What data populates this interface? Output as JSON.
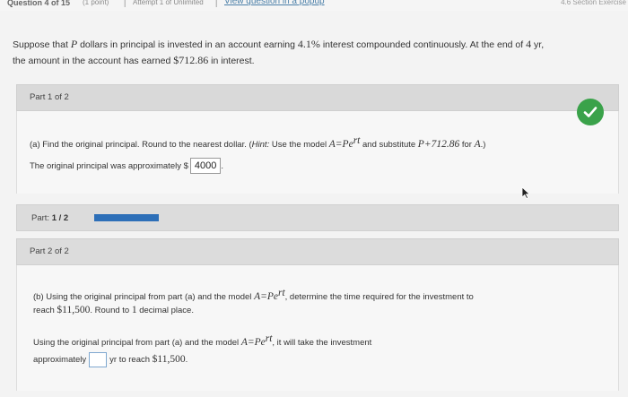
{
  "topbar": {
    "question_label": "Question 4 of 15",
    "points": "(1 point)",
    "attempt": "Attempt 1 of Unlimited",
    "popup_link": "View question in a popup",
    "section": "4.6 Section Exercise"
  },
  "question": {
    "text_1": "Suppose that",
    "var_p": "P",
    "text_2": "dollars in principal is invested in an account earning",
    "rate": "4.1%",
    "text_3": "interest compounded continuously. At the end of",
    "years": "4",
    "text_4": "yr,",
    "text_5": "the amount in the account has earned",
    "interest": "$712.86",
    "text_6": "in interest."
  },
  "part1": {
    "header": "Part 1 of 2",
    "prompt_prefix": "(a) Find the original principal. Round to the nearest dollar. (",
    "hint_label": "Hint:",
    "prompt_mid": " Use the model ",
    "model": "A=Pe",
    "exponent": "rt",
    "prompt_sub": " and substitute ",
    "substitute": "P+712.86",
    "prompt_for": " for ",
    "var_a": "A",
    "prompt_end": ".)",
    "answer_prefix": "The original principal was approximately",
    "currency": "$",
    "answer_value": "4000",
    "answer_suffix": "."
  },
  "progress": {
    "label": "Part:",
    "value": "1 / 2",
    "fraction": 1.0
  },
  "part2": {
    "header": "Part 2 of 2",
    "prompt_1": "(b) Using the original principal from part (a) and the model",
    "model": "A=Pe",
    "exponent": "rt",
    "prompt_2": ", determine the time required for the investment to",
    "prompt_3": "reach",
    "target": "$11,500",
    "prompt_4": ". Round to",
    "decimals": "1",
    "prompt_5": "decimal place.",
    "answer_1": "Using the original principal from part (a) and the model",
    "answer_2": ", it will take the investment",
    "answer_3": "approximately",
    "answer_4": "yr to reach",
    "answer_target": "$11,500",
    "answer_end": "."
  },
  "colors": {
    "check": "#3aa24a",
    "progress": "#2d6fb8",
    "link": "#4a7fa8"
  }
}
